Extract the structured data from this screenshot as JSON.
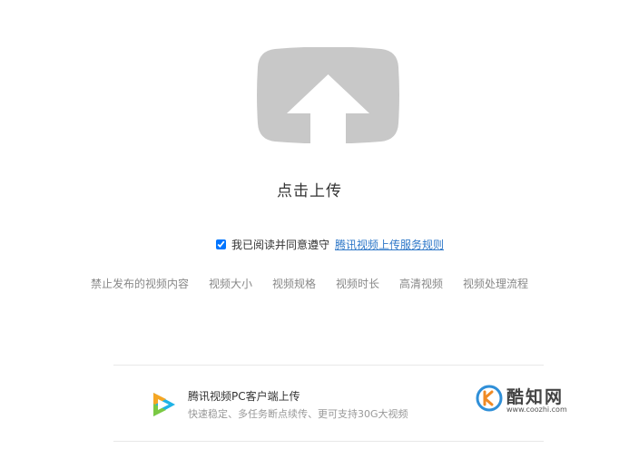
{
  "upload": {
    "label": "点击上传",
    "icon": "upload-arrow-icon",
    "color": "#c8c8c8"
  },
  "agreement": {
    "checked": true,
    "text": "我已阅读并同意遵守",
    "link_text": "腾讯视频上传服务规则",
    "link_color": "#2f78c8"
  },
  "info_links": [
    "禁止发布的视频内容",
    "视频大小",
    "视频规格",
    "视频时长",
    "高清视频",
    "视频处理流程"
  ],
  "client": {
    "title": "腾讯视频PC客户端上传",
    "subtitle": "快速稳定、多任务断点续传、更可支持30G大视频",
    "icon": "tencent-video-logo-icon"
  },
  "watermark": {
    "name": "酷知网",
    "url": "www.coozhi.com"
  }
}
